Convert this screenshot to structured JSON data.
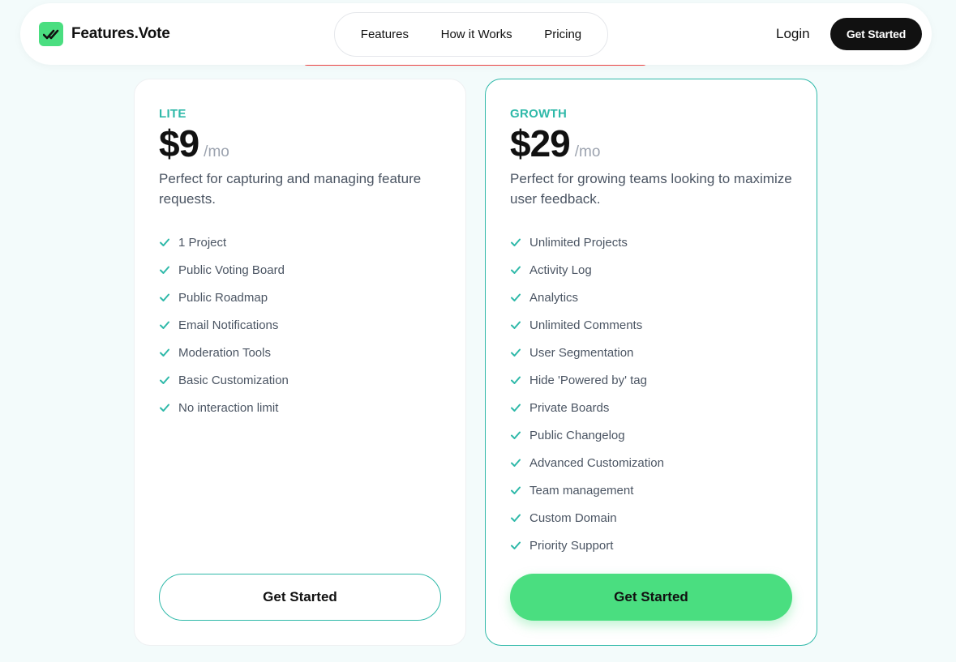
{
  "header": {
    "brand": "Features.Vote",
    "nav": [
      "Features",
      "How it Works",
      "Pricing"
    ],
    "login": "Login",
    "cta": "Get Started"
  },
  "colors": {
    "accent": "#2fb9a9",
    "brand_green": "#4ade80",
    "dark": "#111111",
    "alert": "#ef4444"
  },
  "plans": [
    {
      "tier": "LITE",
      "price": "$9",
      "per": "/mo",
      "description": "Perfect for capturing and managing feature requests.",
      "features": [
        "1 Project",
        "Public Voting Board",
        "Public Roadmap",
        "Email Notifications",
        "Moderation Tools",
        "Basic Customization",
        "No interaction limit"
      ],
      "cta": "Get Started"
    },
    {
      "tier": "GROWTH",
      "price": "$29",
      "per": "/mo",
      "description": "Perfect for growing teams looking to maximize user feedback.",
      "features": [
        "Unlimited Projects",
        "Activity Log",
        "Analytics",
        "Unlimited Comments",
        "User Segmentation",
        "Hide 'Powered by' tag",
        "Private Boards",
        "Public Changelog",
        "Advanced Customization",
        "Team management",
        "Custom Domain",
        "Priority Support"
      ],
      "cta": "Get Started"
    }
  ]
}
